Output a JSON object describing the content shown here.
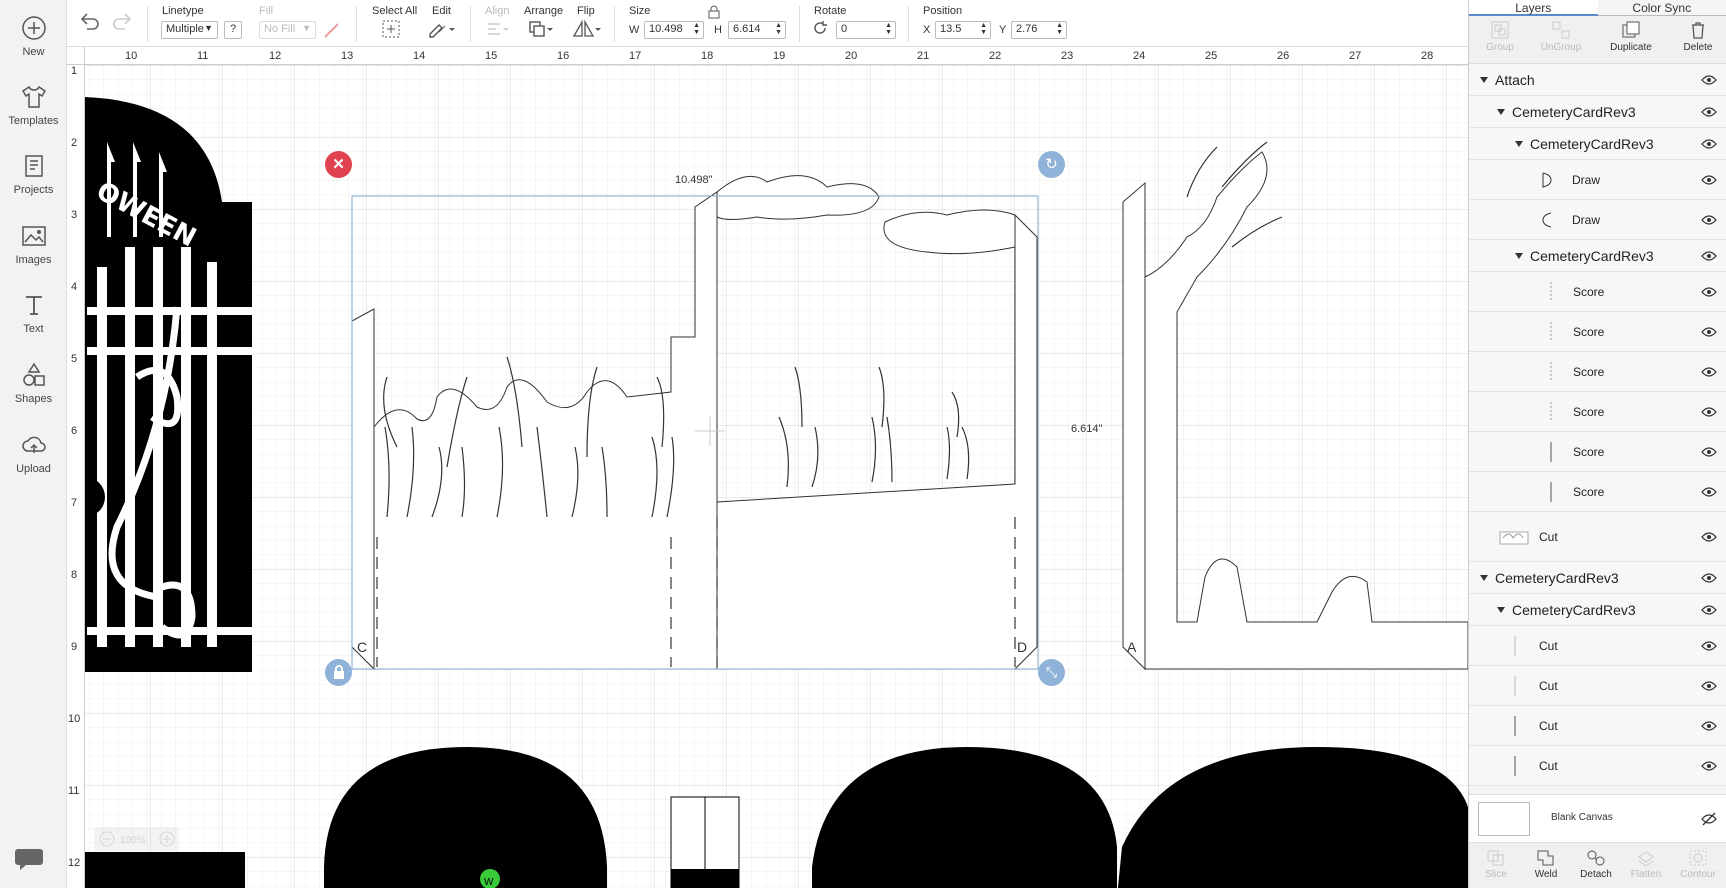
{
  "leftnav": {
    "items": [
      {
        "label": "New",
        "icon": "plus-circle-icon"
      },
      {
        "label": "Templates",
        "icon": "shirt-icon"
      },
      {
        "label": "Projects",
        "icon": "projects-icon"
      },
      {
        "label": "Images",
        "icon": "image-icon"
      },
      {
        "label": "Text",
        "icon": "text-icon"
      },
      {
        "label": "Shapes",
        "icon": "shapes-icon"
      },
      {
        "label": "Upload",
        "icon": "cloud-upload-icon"
      }
    ]
  },
  "toolbar": {
    "linetype_label": "Linetype",
    "linetype_value": "Multiple",
    "help": "?",
    "fill_label": "Fill",
    "fill_value": "No Fill",
    "select_all_label": "Select All",
    "edit_label": "Edit",
    "align_label": "Align",
    "arrange_label": "Arrange",
    "flip_label": "Flip",
    "size_label": "Size",
    "w_label": "W",
    "w_value": "10.498",
    "h_label": "H",
    "h_value": "6.614",
    "rotate_label": "Rotate",
    "rotate_value": "0",
    "position_label": "Position",
    "x_label": "X",
    "x_value": "13.5",
    "y_label": "Y",
    "y_value": "2.76"
  },
  "canvas": {
    "ruler_top": [
      "10",
      "11",
      "12",
      "13",
      "14",
      "15",
      "16",
      "17",
      "18",
      "19",
      "20",
      "21",
      "22",
      "23",
      "24",
      "25",
      "26",
      "27",
      "28"
    ],
    "ruler_left": [
      "1",
      "2",
      "3",
      "4",
      "5",
      "6",
      "7",
      "8",
      "9",
      "10",
      "11",
      "12"
    ],
    "width_dim": "10.498\"",
    "height_dim": "6.614\"",
    "zoom": "100%",
    "gate_text": "OWEEN",
    "letters": {
      "c": "C",
      "d": "D",
      "a": "A",
      "w": "W"
    }
  },
  "rightpanel": {
    "tabs": [
      "Layers",
      "Color Sync"
    ],
    "actions": [
      {
        "label": "Group",
        "enabled": false
      },
      {
        "label": "UnGroup",
        "enabled": false
      },
      {
        "label": "Duplicate",
        "enabled": true
      },
      {
        "label": "Delete",
        "enabled": true
      }
    ],
    "layers": [
      {
        "name": "Attach"
      },
      {
        "name": "CemeteryCardRev3"
      },
      {
        "name": "CemeteryCardRev3"
      },
      {
        "name": "Draw"
      },
      {
        "name": "Draw"
      },
      {
        "name": "CemeteryCardRev3"
      },
      {
        "name": "Score"
      },
      {
        "name": "Score"
      },
      {
        "name": "Score"
      },
      {
        "name": "Score"
      },
      {
        "name": "Score"
      },
      {
        "name": "Score"
      },
      {
        "name": "Cut"
      },
      {
        "name": "CemeteryCardRev3"
      },
      {
        "name": "CemeteryCardRev3"
      },
      {
        "name": "Cut"
      },
      {
        "name": "Cut"
      },
      {
        "name": "Cut"
      },
      {
        "name": "Cut"
      }
    ],
    "blank_canvas": "Blank Canvas",
    "bottom_actions": [
      {
        "label": "Slice",
        "enabled": false
      },
      {
        "label": "Weld",
        "enabled": true
      },
      {
        "label": "Detach",
        "enabled": true
      },
      {
        "label": "Flatten",
        "enabled": false
      },
      {
        "label": "Contour",
        "enabled": false
      }
    ]
  },
  "colors": {
    "selection": "#7fa7cf",
    "delete_handle": "#e0424f",
    "handle_blue": "#8eb2d8",
    "grid": "#e3e3e3",
    "tab_accent": "#5a8ac7"
  }
}
